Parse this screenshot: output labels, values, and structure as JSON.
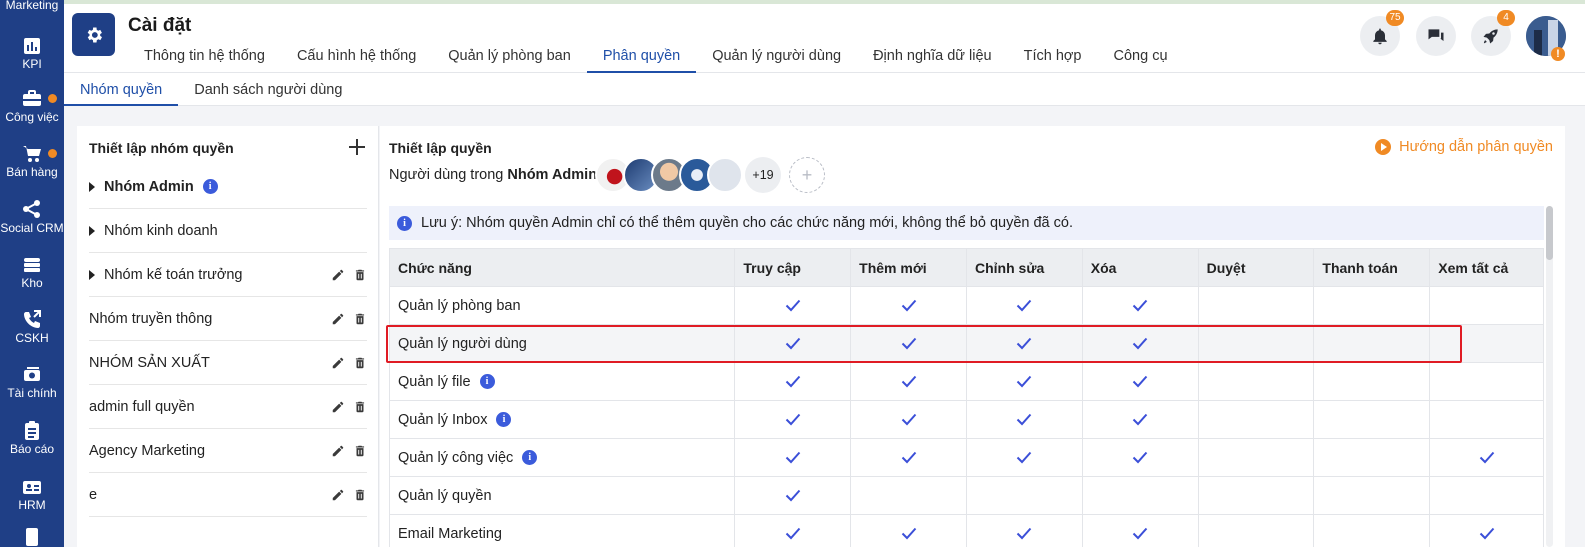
{
  "sidebar": {
    "items": [
      {
        "label": "Marketing",
        "icon": "megaphone-icon"
      },
      {
        "label": "KPI",
        "icon": "bar-chart-icon"
      },
      {
        "label": "Công việc",
        "icon": "briefcase-icon",
        "dot": true
      },
      {
        "label": "Bán hàng",
        "icon": "cart-icon",
        "dot": true
      },
      {
        "label": "Social CRM",
        "icon": "share-icon"
      },
      {
        "label": "Kho",
        "icon": "warehouse-icon"
      },
      {
        "label": "CSKH",
        "icon": "phone-icon"
      },
      {
        "label": "Tài chính",
        "icon": "money-icon"
      },
      {
        "label": "Báo cáo",
        "icon": "clipboard-icon"
      },
      {
        "label": "HRM",
        "icon": "id-card-icon"
      }
    ]
  },
  "header": {
    "title": "Cài đặt",
    "tabs": [
      {
        "label": "Thông tin hệ thống"
      },
      {
        "label": "Cấu hình hệ thống"
      },
      {
        "label": "Quản lý phòng ban"
      },
      {
        "label": "Phân quyền",
        "active": true
      },
      {
        "label": "Quản lý người dùng"
      },
      {
        "label": "Định nghĩa dữ liệu"
      },
      {
        "label": "Tích hợp"
      },
      {
        "label": "Công cụ"
      }
    ],
    "notifications_badge": "75",
    "rocket_badge": "4",
    "warning_mark": "!"
  },
  "subtabs": [
    {
      "label": "Nhóm quyền",
      "active": true
    },
    {
      "label": "Danh sách người dùng"
    }
  ],
  "left_panel": {
    "title": "Thiết lập nhóm quyền",
    "groups": [
      {
        "label": "Nhóm Admin",
        "bold": true,
        "expandable": true,
        "info": true,
        "actions": false
      },
      {
        "label": "Nhóm kinh doanh",
        "expandable": true,
        "actions": false
      },
      {
        "label": "Nhóm kế toán trưởng",
        "expandable": true,
        "actions": true
      },
      {
        "label": "Nhóm truyền thông",
        "actions": true
      },
      {
        "label": "NHÓM SẢN XUẤT",
        "actions": true
      },
      {
        "label": "admin full quyền",
        "actions": true
      },
      {
        "label": "Agency Marketing",
        "actions": true
      },
      {
        "label": "e",
        "actions": true
      }
    ]
  },
  "right_panel": {
    "title": "Thiết lập quyền",
    "guide_label": "Hướng dẫn phân quyền",
    "users_prefix": "Người dùng trong",
    "users_group": "Nhóm Admin:",
    "more_users": "+19",
    "note": "Lưu ý: Nhóm quyền Admin chỉ có thể thêm quyền cho các chức năng mới, không thể bỏ quyền đã có.",
    "columns": [
      "Chức năng",
      "Truy cập",
      "Thêm mới",
      "Chỉnh sửa",
      "Xóa",
      "Duyệt",
      "Thanh toán",
      "Xem tất cả"
    ],
    "rows": [
      {
        "name": "Quản lý phòng ban",
        "info": false,
        "checks": [
          true,
          true,
          true,
          true,
          false,
          false,
          false
        ]
      },
      {
        "name": "Quản lý người dùng",
        "info": false,
        "highlight": true,
        "checks": [
          true,
          true,
          true,
          true,
          false,
          false,
          false
        ]
      },
      {
        "name": "Quản lý file",
        "info": true,
        "checks": [
          true,
          true,
          true,
          true,
          false,
          false,
          false
        ]
      },
      {
        "name": "Quản lý Inbox",
        "info": true,
        "checks": [
          true,
          true,
          true,
          true,
          false,
          false,
          false
        ]
      },
      {
        "name": "Quản lý công việc",
        "info": true,
        "checks": [
          true,
          true,
          true,
          true,
          false,
          false,
          true
        ]
      },
      {
        "name": "Quản lý quyền",
        "info": false,
        "checks": [
          true,
          false,
          false,
          false,
          false,
          false,
          false
        ]
      },
      {
        "name": "Email Marketing",
        "info": false,
        "checks": [
          true,
          true,
          true,
          true,
          false,
          false,
          true
        ]
      }
    ]
  },
  "colors": {
    "sidebar": "#1f3f86",
    "accent": "#1f4fa8",
    "check": "#3b4fd8",
    "orange": "#f08a24",
    "highlight_box": "#e01b24"
  }
}
